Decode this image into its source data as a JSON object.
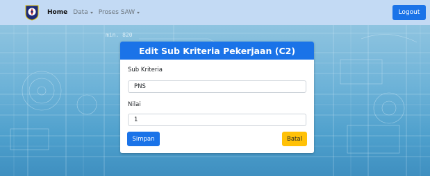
{
  "navbar": {
    "logo_icon": "regional-emblem-icon",
    "items": [
      {
        "label": "Home",
        "active": true,
        "dropdown": false
      },
      {
        "label": "Data",
        "active": false,
        "dropdown": true
      },
      {
        "label": "Proses SAW",
        "active": false,
        "dropdown": true
      }
    ],
    "logout_label": "Logout"
  },
  "form": {
    "title": "Edit Sub Kriteria Pekerjaan (C2)",
    "sub_kriteria_label": "Sub Kriteria",
    "sub_kriteria_value": "PNS",
    "nilai_label": "Nilai",
    "nilai_value": "1",
    "save_label": "Simpan",
    "cancel_label": "Batal"
  },
  "background": {
    "watermark_text": "min. 820"
  },
  "colors": {
    "navbar_bg": "#c3daf4",
    "primary": "#1a73e8",
    "warning": "#ffc107"
  }
}
